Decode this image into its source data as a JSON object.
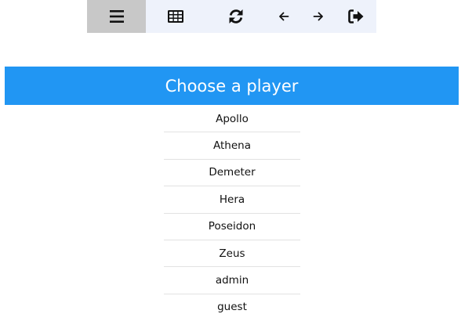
{
  "toolbar": {
    "buttons": [
      {
        "icon": "menu-icon",
        "active": true
      },
      {
        "icon": "grid-icon",
        "active": false
      },
      {
        "icon": "refresh-icon",
        "active": false
      },
      {
        "icon": "arrow-left-icon",
        "active": false
      },
      {
        "icon": "arrow-right-icon",
        "active": false
      },
      {
        "icon": "sign-out-icon",
        "active": false
      }
    ],
    "active_color": "#c8c8c8",
    "background_color": "#eef2fb"
  },
  "header": {
    "title": "Choose a player",
    "background_color": "#2196f3"
  },
  "players": [
    {
      "label": "Apollo"
    },
    {
      "label": "Athena"
    },
    {
      "label": "Demeter"
    },
    {
      "label": "Hera"
    },
    {
      "label": "Poseidon"
    },
    {
      "label": "Zeus"
    },
    {
      "label": "admin"
    },
    {
      "label": "guest"
    }
  ]
}
